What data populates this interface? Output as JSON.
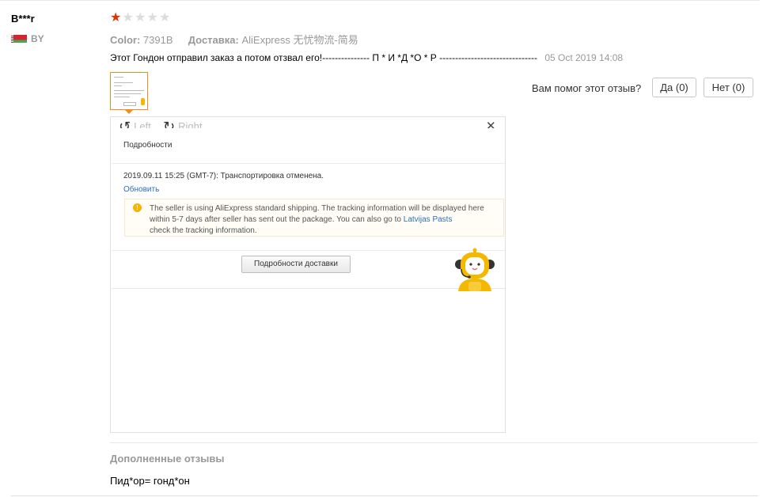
{
  "reviewer": {
    "name": "B***r",
    "country": "BY",
    "flag_icon": "belarus-flag-icon"
  },
  "rating": {
    "stars": 1,
    "max": 5,
    "colors": {
      "filled": "#e62e04",
      "empty": "#dcdcdc"
    }
  },
  "attributes": {
    "color_label": "Color:",
    "color_value": "7391B",
    "delivery_label": "Доставка:",
    "delivery_value": "AliExpress 无忧物流-简易"
  },
  "review": {
    "text": "Этот Гондон отправил заказ а потом отзвал его!--------------- П * И *Д *О * Р -------------------------------",
    "date": "05 Oct 2019 14:08"
  },
  "helpful": {
    "question": "Вам помог этот отзыв?",
    "yes_label": "Да (0)",
    "no_label": "Нет (0)"
  },
  "viewer": {
    "rotate_left_label": "Left",
    "rotate_right_label": "Right",
    "close_icon": "close-icon",
    "screenshot": {
      "details_title": "Подробности",
      "tracking_entry": "2019.09.11 15:25 (GMT-7): Транспортировка отменена.",
      "update_link": "Обновить",
      "notice_text": "The seller is using AliExpress standard shipping. The tracking information will be displayed here within 5-7 days after seller has sent out the package. You can also go to",
      "notice_link": "Latvijas Pasts",
      "notice_tail": "check the tracking information.",
      "delivery_details_button": "Подробности доставки"
    }
  },
  "additional": {
    "title": "Дополненные отзывы",
    "text": "Пид*ор= гонд*он"
  },
  "accent_colors": {
    "thumb_border": "#f08d1e",
    "link": "#2a6ebb",
    "mascot": "#f5b800"
  }
}
